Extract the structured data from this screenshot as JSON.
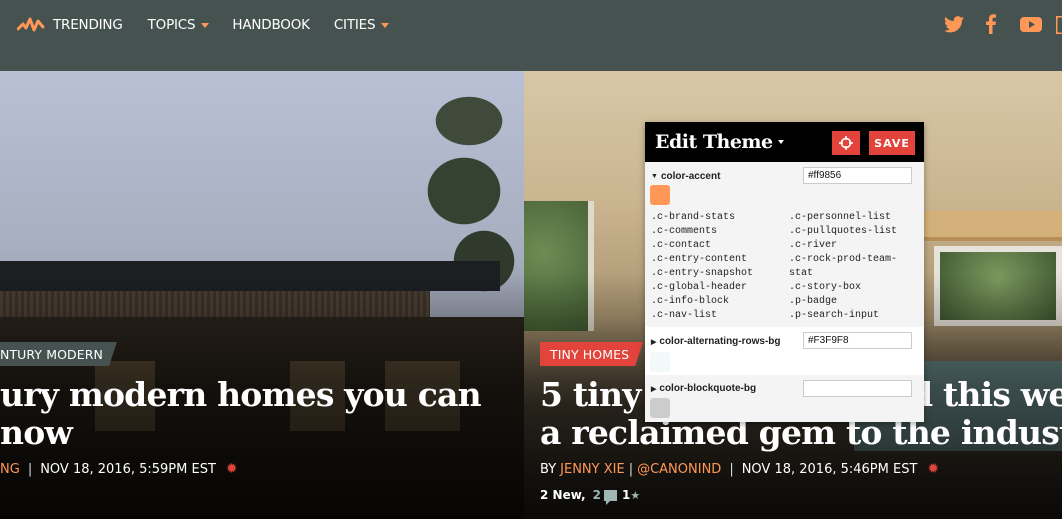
{
  "nav": {
    "logo": "trending-logo",
    "items": [
      {
        "label": "Trending",
        "dropdown": false
      },
      {
        "label": "Topics",
        "dropdown": true
      },
      {
        "label": "Handbook",
        "dropdown": false
      },
      {
        "label": "Cities",
        "dropdown": true
      }
    ],
    "social": [
      "twitter-icon",
      "facebook-icon",
      "youtube-icon",
      "instagram-icon"
    ]
  },
  "colors": {
    "accent": "#ff9856",
    "nav_bg": "#45524f",
    "tag_red": "#e2433a"
  },
  "stories": [
    {
      "tag": "ntury modern",
      "headline_line1": "ury modern homes you can",
      "headline_line2": "now",
      "byline_author": "ng",
      "date": "Nov 18, 2016, 5:59pm EST"
    },
    {
      "tag": "Tiny Homes",
      "headline_line1": "5 tiny",
      "headline_line1_end": "d this we",
      "headline_line2": "a reclaimed gem to the industr",
      "byline_prefix": "By",
      "byline_author": "Jenny Xie",
      "byline_handle": "@CanonInd",
      "date": "Nov 18, 2016, 5:46pm EST",
      "new_count": "2 New,",
      "comments": "2",
      "recommends": "1"
    }
  ],
  "edit_theme": {
    "title": "Edit Theme",
    "save_label": "SAVE",
    "variables": [
      {
        "name": "color-accent",
        "expanded": true,
        "value": "#ff9856",
        "swatch": "#ff9856",
        "classes": [
          ".c-brand-stats",
          ".c-comments",
          ".c-contact",
          ".c-entry-content",
          ".c-entry-snapshot",
          ".c-global-header",
          ".c-info-block",
          ".c-nav-list",
          ".c-personnel-list",
          ".c-pullquotes-list",
          ".c-river",
          ".c-rock-prod-team-",
          "stat",
          ".c-story-box",
          ".p-badge",
          ".p-search-input"
        ]
      },
      {
        "name": "color-alternating-rows-bg",
        "expanded": false,
        "value": "#F3F9F8",
        "swatch": "#F3F9F8"
      },
      {
        "name": "color-blockquote-bg",
        "expanded": false,
        "value": "",
        "swatch": "#cccccc"
      }
    ]
  }
}
